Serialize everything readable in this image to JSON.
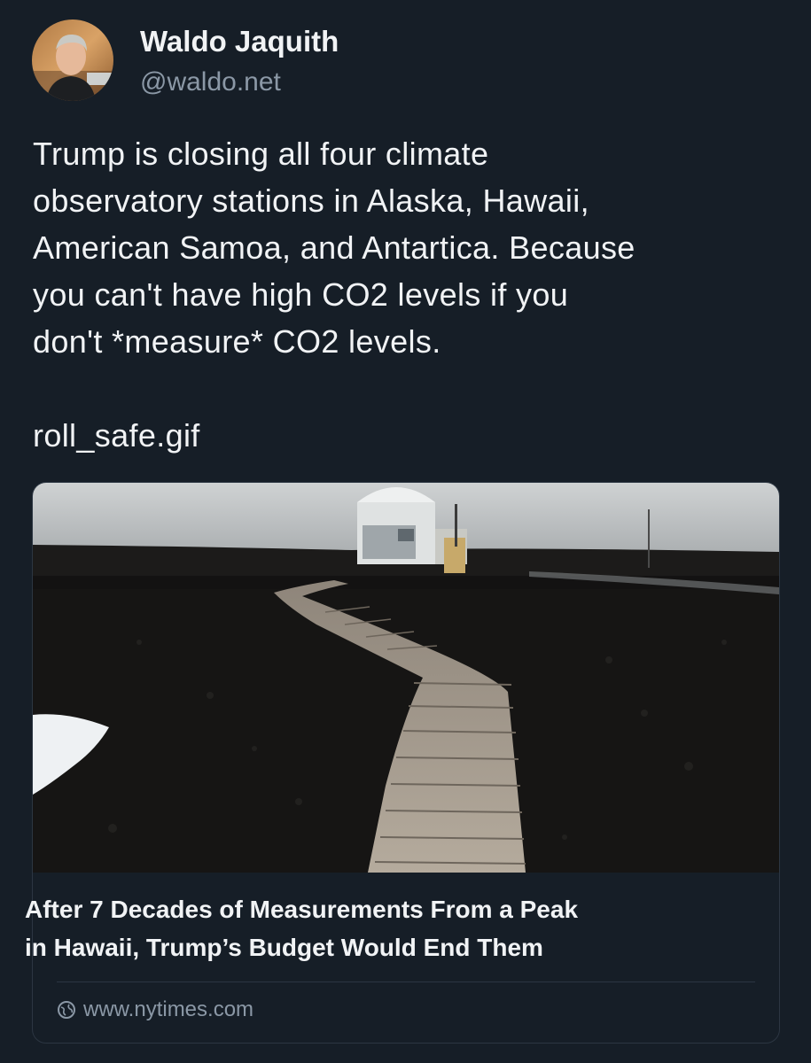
{
  "author": {
    "display_name": "Waldo Jaquith",
    "handle": "@waldo.net",
    "avatar_icon": "user-avatar-photo"
  },
  "post": {
    "lines": [
      "Trump is closing all four climate",
      "observatory stations in Alaska, Hawaii,",
      "American Samoa, and Antartica. Because",
      "you can't have high CO2 levels if you",
      "don't *measure* CO2 levels."
    ],
    "attachment_text": "roll_safe.gif"
  },
  "link_card": {
    "image_icon": "observatory-boardwalk-photo",
    "title_lines": [
      "After 7 Decades of Measurements From a Peak",
      "in Hawaii, Trump’s Budget Would End Them"
    ],
    "domain": "www.nytimes.com",
    "domain_icon": "globe-icon"
  },
  "colors": {
    "background": "#161e27",
    "text_primary": "#f1f3f5",
    "text_secondary": "#8b98a6",
    "border": "#2c3642"
  }
}
